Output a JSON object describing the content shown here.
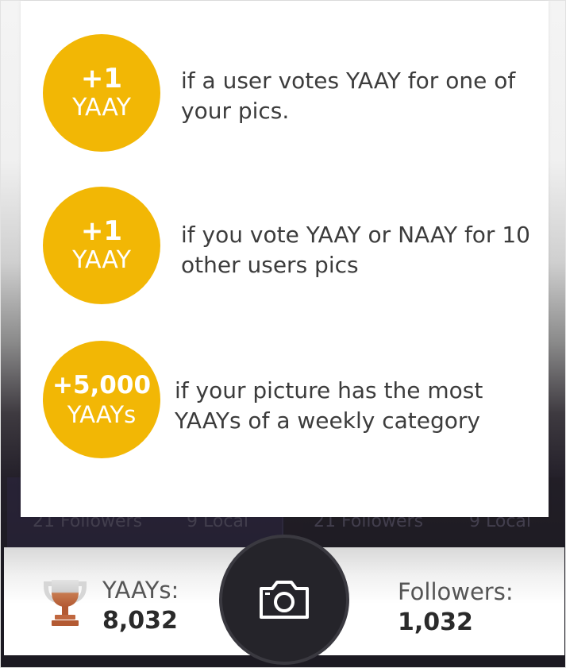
{
  "background_cards": {
    "left": {
      "followers": "21 Followers",
      "local": "9 Local"
    },
    "right": {
      "followers": "21 Followers",
      "local": "9 Local"
    }
  },
  "rewards": [
    {
      "amount": "+1",
      "unit": "YAAY",
      "description": "if a user votes YAAY for one of your pics."
    },
    {
      "amount": "+1",
      "unit": "YAAY",
      "description": "if you vote YAAY or NAAY for 10 other users pics"
    },
    {
      "amount": "+5,000",
      "unit": "YAAYs",
      "description": "if your picture has the most YAAYs of a weekly category"
    }
  ],
  "stats": {
    "yaays_label": "YAAYs:",
    "yaays_count": "8,032",
    "followers_label": "Followers:",
    "followers_count": "1,032"
  },
  "icons": {
    "trophy": "trophy-icon",
    "camera": "camera-icon"
  },
  "colors": {
    "badge": "#f2b705",
    "trophy_top": "#d9d9d9",
    "trophy_bottom": "#c0673f",
    "camera_button": "#25242a"
  }
}
